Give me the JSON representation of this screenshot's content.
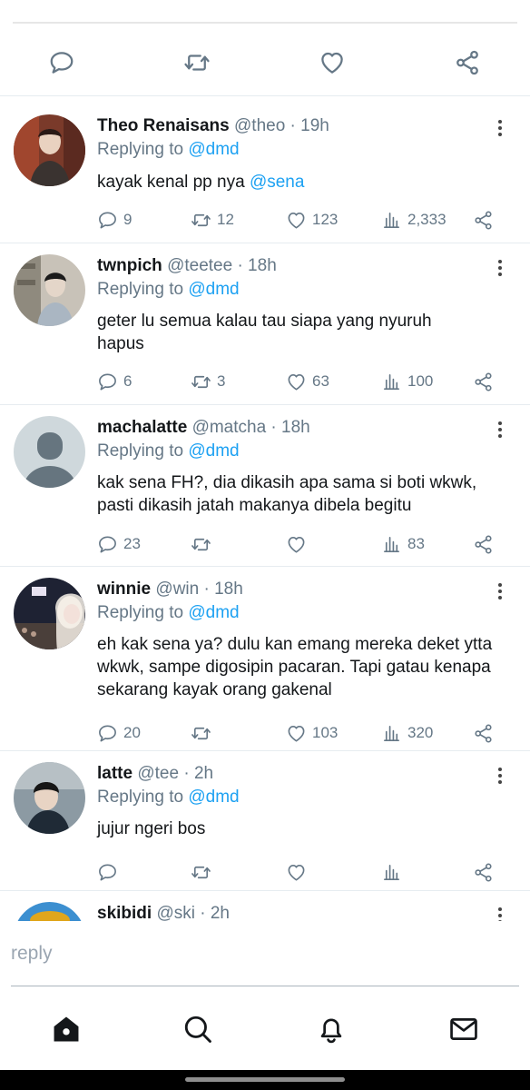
{
  "icons": {
    "reply": "speech-bubble-icon",
    "retweet": "retweet-icon",
    "like": "heart-icon",
    "views": "bar-chart-icon",
    "share": "share-icon",
    "more": "vertical-ellipsis-icon"
  },
  "colors": {
    "accent": "#1da1f2",
    "text": "#14171a",
    "muted": "#657786"
  },
  "tweets": [
    {
      "name": "Theo Renaisans",
      "meta": "@theo · 19h",
      "replying_prefix": "Replying to",
      "replying_to": "@dmd",
      "text": "kayak kenal pp nya ",
      "text_mention": "@sena",
      "replies": "9",
      "retweets": "12",
      "likes": "123",
      "views": "2,333"
    },
    {
      "name": "twnpich",
      "meta": "@teetee · 18h",
      "replying_prefix": "Replying to",
      "replying_to": "@dmd",
      "text": "geter lu semua kalau tau siapa yang nyuruh hapus",
      "replies": "6",
      "retweets": "3",
      "likes": "63",
      "views": "100"
    },
    {
      "name": "machalatte",
      "meta": "@matcha · 18h",
      "replying_prefix": "Replying to",
      "replying_to": "@dmd",
      "text": "kak sena FH?, dia dikasih apa sama si boti wkwk, pasti dikasih jatah makanya dibela begitu",
      "replies": "23",
      "retweets": "",
      "likes": "",
      "views": "83"
    },
    {
      "name": "winnie",
      "meta": "@win · 18h",
      "replying_prefix": "Replying to",
      "replying_to": "@dmd",
      "text": "eh kak sena ya? dulu kan emang mereka deket ytta wkwk, sampe digosipin pacaran. Tapi gatau kenapa sekarang kayak orang gakenal",
      "replies": "20",
      "retweets": "",
      "likes": "103",
      "views": "320"
    },
    {
      "name": "latte",
      "meta": "@tee · 2h",
      "replying_prefix": "Replying to",
      "replying_to": "@dmd",
      "text": "jujur ngeri bos",
      "replies": "",
      "retweets": "",
      "likes": "",
      "views": ""
    },
    {
      "name": "skibidi",
      "meta": "@ski · 2h"
    }
  ],
  "reply_box": {
    "placeholder": "reply"
  },
  "bottom_nav": [
    "home-icon",
    "search-icon",
    "bell-icon",
    "mail-icon"
  ]
}
